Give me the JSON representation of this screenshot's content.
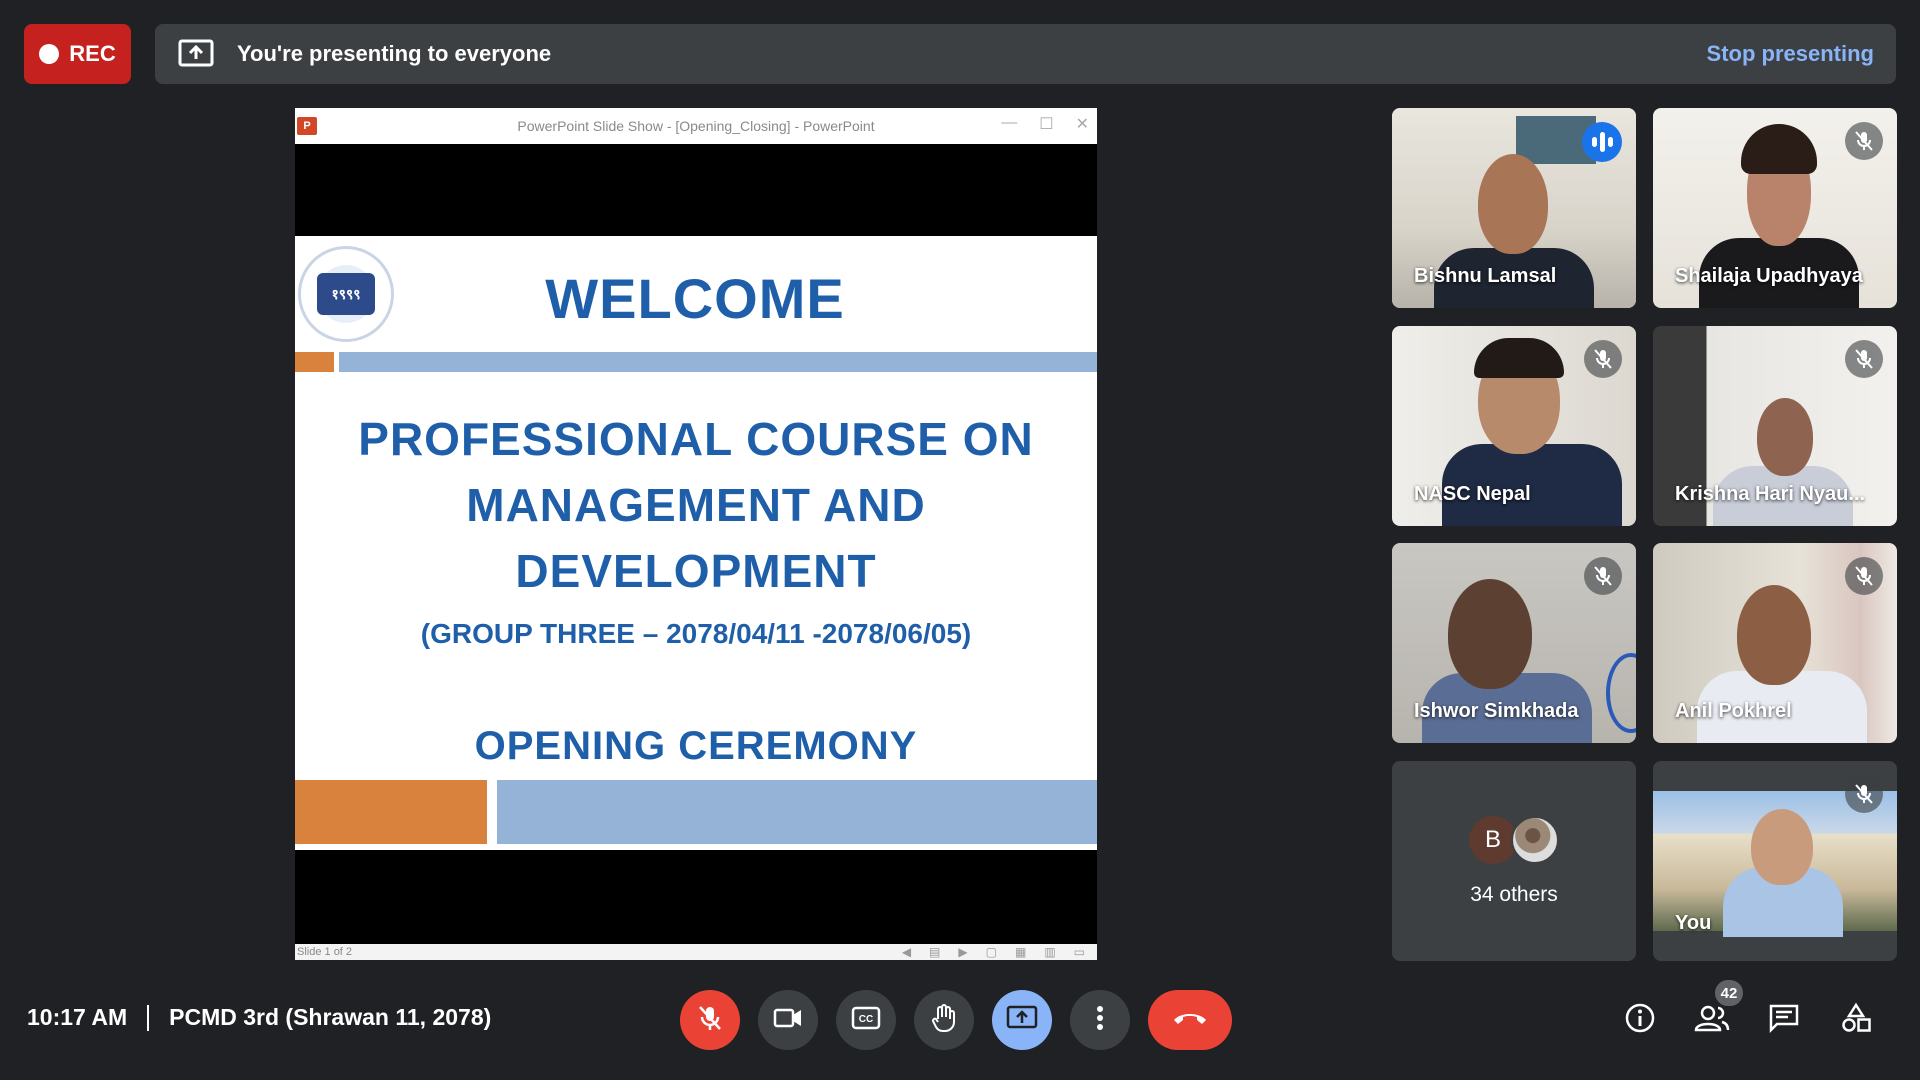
{
  "recording": {
    "label": "REC"
  },
  "presenting": {
    "text": "You're presenting to everyone",
    "stop_label": "Stop presenting"
  },
  "slide_window": {
    "title": "PowerPoint Slide Show - [Opening_Closing] - PowerPoint",
    "app_badge": "P",
    "status": "Slide 1 of 2"
  },
  "slide": {
    "logo_text": "१९९९",
    "welcome": "WELCOME",
    "course_line1": "PROFESSIONAL COURSE ON",
    "course_line2": "MANAGEMENT AND",
    "course_line3": "DEVELOPMENT",
    "group": "(GROUP THREE – 2078/04/11 -2078/06/05)",
    "ceremony": "OPENING CEREMONY"
  },
  "participants": [
    {
      "name": "Bishnu Lamsal",
      "state": "speaking"
    },
    {
      "name": "Shailaja Upadhyaya",
      "state": "muted"
    },
    {
      "name": "NASC Nepal",
      "state": "muted"
    },
    {
      "name": "Krishna Hari Nyau...",
      "state": "muted"
    },
    {
      "name": "Ishwor Simkhada",
      "state": "muted"
    },
    {
      "name": "Anil Pokhrel",
      "state": "muted"
    },
    {
      "name": "You",
      "state": "muted"
    }
  ],
  "others": {
    "initial": "B",
    "label": "34 others"
  },
  "meeting": {
    "time": "10:17 AM",
    "title": "PCMD 3rd (Shrawan 11, 2078)"
  },
  "people_count": "42",
  "colors": {
    "rec": "#c5221f",
    "accent": "#8ab4f8",
    "hangup": "#ea4335",
    "slide_blue": "#1f5fa9",
    "slide_orange": "#d9823e",
    "slide_bar": "#95b3d7"
  }
}
